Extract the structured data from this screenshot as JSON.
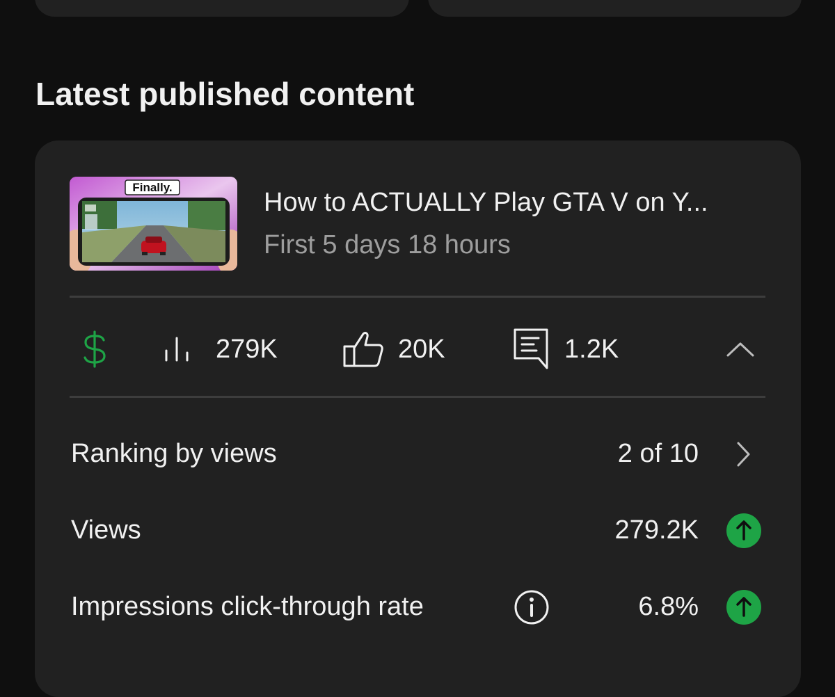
{
  "section": {
    "title": "Latest published content"
  },
  "video": {
    "thumbnail_caption": "Finally.",
    "title": "How to ACTUALLY Play GTA V on Y...",
    "subtitle": "First 5 days 18 hours"
  },
  "stats": {
    "revenue_icon": "dollar-icon",
    "views": "279K",
    "likes": "20K",
    "comments": "1.2K"
  },
  "metrics": [
    {
      "label": "Ranking by views",
      "value": "2 of 10",
      "icon": "chevron-right-icon"
    },
    {
      "label": "Views",
      "value": "279.2K",
      "icon": "trend-up-icon"
    },
    {
      "label": "Impressions click-through rate",
      "value": "6.8%",
      "icon": "trend-up-icon",
      "info_icon": "info-icon"
    }
  ],
  "colors": {
    "background": "#0f0f0f",
    "card": "#212121",
    "accent_green": "#1ea446",
    "muted_text": "#9e9e9e"
  }
}
